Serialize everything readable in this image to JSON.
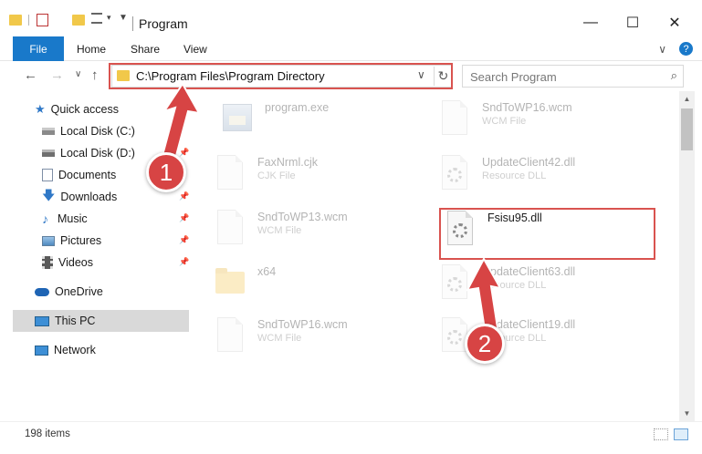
{
  "window": {
    "title": "Program",
    "minimize": "—",
    "maximize": "☐",
    "close": "✕"
  },
  "ribbon": {
    "tabs": [
      "File",
      "Home",
      "Share",
      "View"
    ],
    "expand_glyph": "∨",
    "help_glyph": "?"
  },
  "nav": {
    "back": "←",
    "forward": "→",
    "recent": "∨",
    "up": "↑"
  },
  "address": {
    "path": "C:\\Program Files\\Program Directory",
    "chevron": "∨",
    "refresh": "↻"
  },
  "search": {
    "placeholder": "Search Program",
    "icon_glyph": "⌕"
  },
  "sidebar": {
    "items": [
      {
        "label": "Quick access",
        "icon": "star-icon"
      },
      {
        "label": "Local Disk (C:)",
        "icon": "drive-icon"
      },
      {
        "label": "Local Disk (D:)",
        "icon": "drive-icon"
      },
      {
        "label": "Documents",
        "icon": "documents-icon"
      },
      {
        "label": "Downloads",
        "icon": "download-icon"
      },
      {
        "label": "Music",
        "icon": "music-icon"
      },
      {
        "label": "Pictures",
        "icon": "pictures-icon"
      },
      {
        "label": "Videos",
        "icon": "videos-icon"
      },
      {
        "label": "OneDrive",
        "icon": "cloud-icon"
      },
      {
        "label": "This PC",
        "icon": "monitor-icon"
      },
      {
        "label": "Network",
        "icon": "network-icon"
      }
    ],
    "pin_glyph": "📌"
  },
  "files": {
    "items": [
      {
        "name": "program.exe",
        "type": "",
        "icon": "exe-icon"
      },
      {
        "name": "SndToWP16.wcm",
        "type": "WCM File",
        "icon": "file-icon"
      },
      {
        "name": "FaxNrml.cjk",
        "type": "CJK File",
        "icon": "file-icon"
      },
      {
        "name": "UpdateClient42.dll",
        "type": "Resource DLL",
        "icon": "dll-gear-icon"
      },
      {
        "name": "SndToWP13.wcm",
        "type": "WCM File",
        "icon": "file-icon"
      },
      {
        "name": "Fsisu95.dll",
        "type": "",
        "icon": "dll-gear-icon"
      },
      {
        "name": "x64",
        "type": "",
        "icon": "folder-icon"
      },
      {
        "name": "UpdateClient63.dll",
        "type": "Resource DLL",
        "icon": "dll-gear-icon"
      },
      {
        "name": "SndToWP16.wcm",
        "type": "WCM File",
        "icon": "file-icon"
      },
      {
        "name": "UpdateClient19.dll",
        "type": "Resource DLL",
        "icon": "dll-gear-icon"
      }
    ]
  },
  "status": {
    "item_count": "198 items"
  },
  "callouts": {
    "step1": "1",
    "step2": "2",
    "color": "#d74444"
  }
}
